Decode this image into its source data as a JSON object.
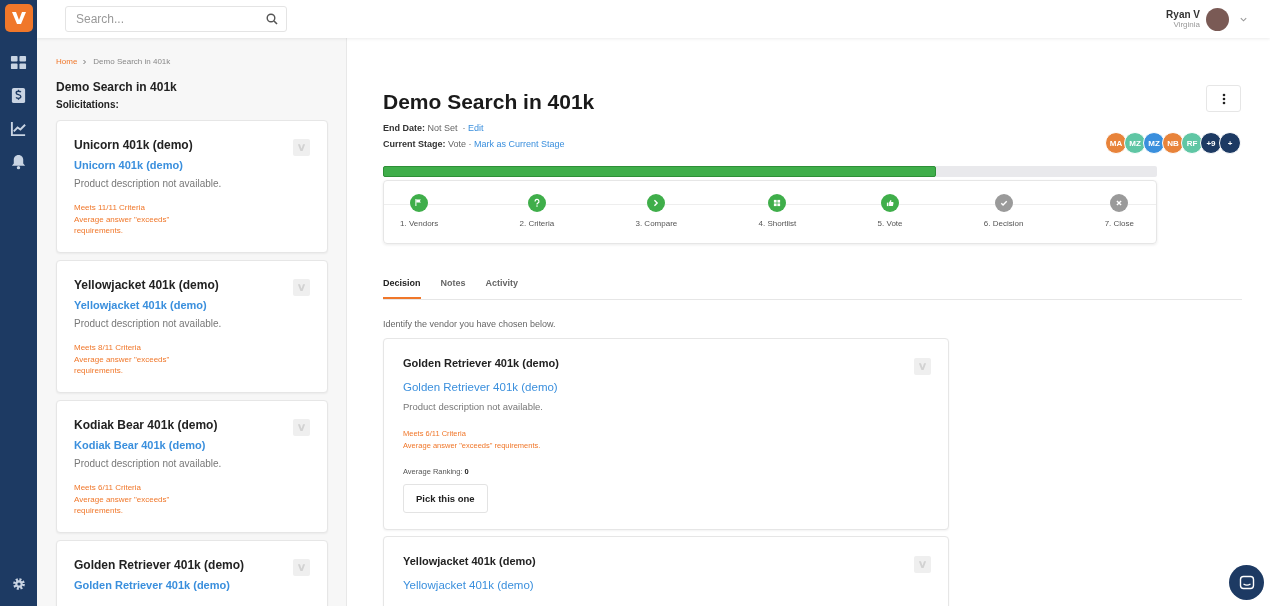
{
  "search": {
    "placeholder": "Search..."
  },
  "user": {
    "name": "Ryan V",
    "location": "Virginia"
  },
  "breadcrumb": [
    "Home",
    "Demo Search in 401k"
  ],
  "sidebar": {
    "title": "Demo Search in 401k",
    "subtitle": "Solicitations:",
    "cards": [
      {
        "title": "Unicorn 401k (demo)",
        "link": "Unicorn 401k (demo)",
        "description": "Product description not available.",
        "criteria": "Meets 11/11 Criteria",
        "answer": "Average answer \"exceeds\" requirements."
      },
      {
        "title": "Yellowjacket 401k (demo)",
        "link": "Yellowjacket 401k (demo)",
        "description": "Product description not available.",
        "criteria": "Meets 8/11 Criteria",
        "answer": "Average answer \"exceeds\" requirements."
      },
      {
        "title": "Kodiak Bear 401k (demo)",
        "link": "Kodiak Bear 401k (demo)",
        "description": "Product description not available.",
        "criteria": "Meets 6/11 Criteria",
        "answer": "Average answer \"exceeds\" requirements."
      },
      {
        "title": "Golden Retriever 401k (demo)",
        "link": "Golden Retriever 401k (demo)"
      }
    ]
  },
  "header": {
    "title": "Demo Search in 401k",
    "end_date_label": "End Date:",
    "end_date": "Not Set",
    "end_date_separator": "·",
    "edit": "Edit",
    "stage_label": "Current Stage:",
    "stage": "Vote",
    "stage_separator": "·",
    "mark_stage": "Mark as Current Stage",
    "members": [
      {
        "initials": "MA",
        "color": "#e8833a"
      },
      {
        "initials": "MZ",
        "color": "#5fc6a4"
      },
      {
        "initials": "MZ",
        "color": "#3a8fdd"
      },
      {
        "initials": "NB",
        "color": "#e8833a"
      },
      {
        "initials": "RF",
        "color": "#5fc6a4"
      },
      {
        "initials": "+9",
        "color": "#1d3a63"
      },
      {
        "initials": "+",
        "color": "#1d3a63"
      }
    ]
  },
  "progress": {
    "level": 0.714
  },
  "steps": [
    {
      "label": "1. Vendors",
      "done": true
    },
    {
      "label": "2. Criteria",
      "done": true
    },
    {
      "label": "3. Compare",
      "done": true
    },
    {
      "label": "4. Shortlist",
      "done": true
    },
    {
      "label": "5. Vote",
      "done": true
    },
    {
      "label": "6. Decision",
      "done": false
    },
    {
      "label": "7. Close",
      "done": false
    }
  ],
  "tabs": [
    {
      "label": "Decision",
      "selected": true
    },
    {
      "label": "Notes",
      "selected": false
    },
    {
      "label": "Activity",
      "selected": false
    }
  ],
  "instructions": "Identify the vendor you have chosen below.",
  "vendors": [
    {
      "title": "Golden Retriever 401k (demo)",
      "link": "Golden Retriever 401k (demo)",
      "description": "Product description not available.",
      "criteria": "Meets 6/11 Criteria",
      "answer": "Average answer \"exceeds\" requirements.",
      "ranking": "Average Ranking: **0**",
      "button": "Pick this one"
    },
    {
      "title": "Yellowjacket 401k (demo)",
      "link": "Yellowjacket 401k (demo)"
    }
  ]
}
